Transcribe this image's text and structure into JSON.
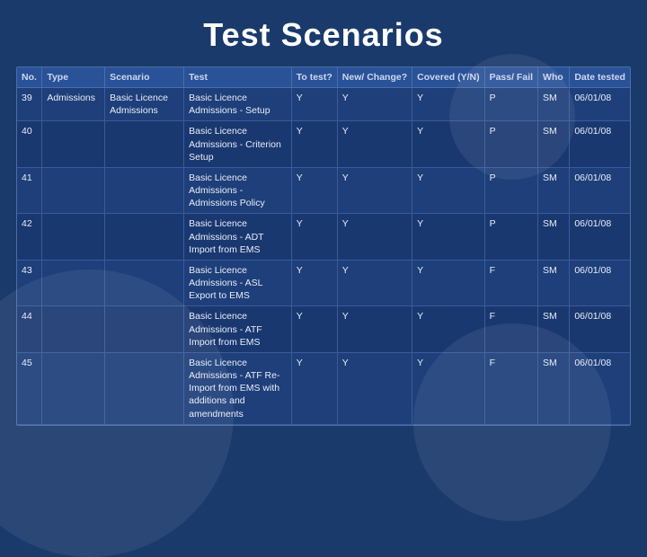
{
  "page": {
    "title": "Test Scenarios",
    "background_color": "#1a3a6b"
  },
  "table": {
    "columns": [
      {
        "key": "no",
        "label": "No.",
        "class": "col-no"
      },
      {
        "key": "type",
        "label": "Type",
        "class": "col-type"
      },
      {
        "key": "scenario",
        "label": "Scenario",
        "class": "col-scenario"
      },
      {
        "key": "test",
        "label": "Test",
        "class": "col-test"
      },
      {
        "key": "totest",
        "label": "To test?",
        "class": "col-totest"
      },
      {
        "key": "newchange",
        "label": "New/ Change?",
        "class": "col-newchange"
      },
      {
        "key": "covered",
        "label": "Covered (Y/N)",
        "class": "col-covered"
      },
      {
        "key": "passfail",
        "label": "Pass/ Fail",
        "class": "col-passfail"
      },
      {
        "key": "who",
        "label": "Who",
        "class": "col-who"
      },
      {
        "key": "datetested",
        "label": "Date tested",
        "class": "col-datetested"
      }
    ],
    "rows": [
      {
        "no": "39",
        "type": "Admissions",
        "scenario": "Basic Licence Admissions",
        "test": "Basic Licence Admissions - Setup",
        "totest": "Y",
        "newchange": "Y",
        "covered": "Y",
        "passfail": "P",
        "who": "SM",
        "datetested": "06/01/08"
      },
      {
        "no": "40",
        "type": "",
        "scenario": "",
        "test": "Basic Licence Admissions - Criterion Setup",
        "totest": "Y",
        "newchange": "Y",
        "covered": "Y",
        "passfail": "P",
        "who": "SM",
        "datetested": "06/01/08"
      },
      {
        "no": "41",
        "type": "",
        "scenario": "",
        "test": "Basic Licence Admissions - Admissions Policy",
        "totest": "Y",
        "newchange": "Y",
        "covered": "Y",
        "passfail": "P",
        "who": "SM",
        "datetested": "06/01/08"
      },
      {
        "no": "42",
        "type": "",
        "scenario": "",
        "test": "Basic Licence Admissions - ADT Import from EMS",
        "totest": "Y",
        "newchange": "Y",
        "covered": "Y",
        "passfail": "P",
        "who": "SM",
        "datetested": "06/01/08"
      },
      {
        "no": "43",
        "type": "",
        "scenario": "",
        "test": "Basic Licence Admissions - ASL Export to EMS",
        "totest": "Y",
        "newchange": "Y",
        "covered": "Y",
        "passfail": "F",
        "who": "SM",
        "datetested": "06/01/08"
      },
      {
        "no": "44",
        "type": "",
        "scenario": "",
        "test": "Basic Licence Admissions - ATF Import from EMS",
        "totest": "Y",
        "newchange": "Y",
        "covered": "Y",
        "passfail": "F",
        "who": "SM",
        "datetested": "06/01/08"
      },
      {
        "no": "45",
        "type": "",
        "scenario": "",
        "test": "Basic Licence Admissions - ATF Re-Import from EMS with additions and amendments",
        "totest": "Y",
        "newchange": "Y",
        "covered": "Y",
        "passfail": "F",
        "who": "SM",
        "datetested": "06/01/08"
      }
    ]
  }
}
